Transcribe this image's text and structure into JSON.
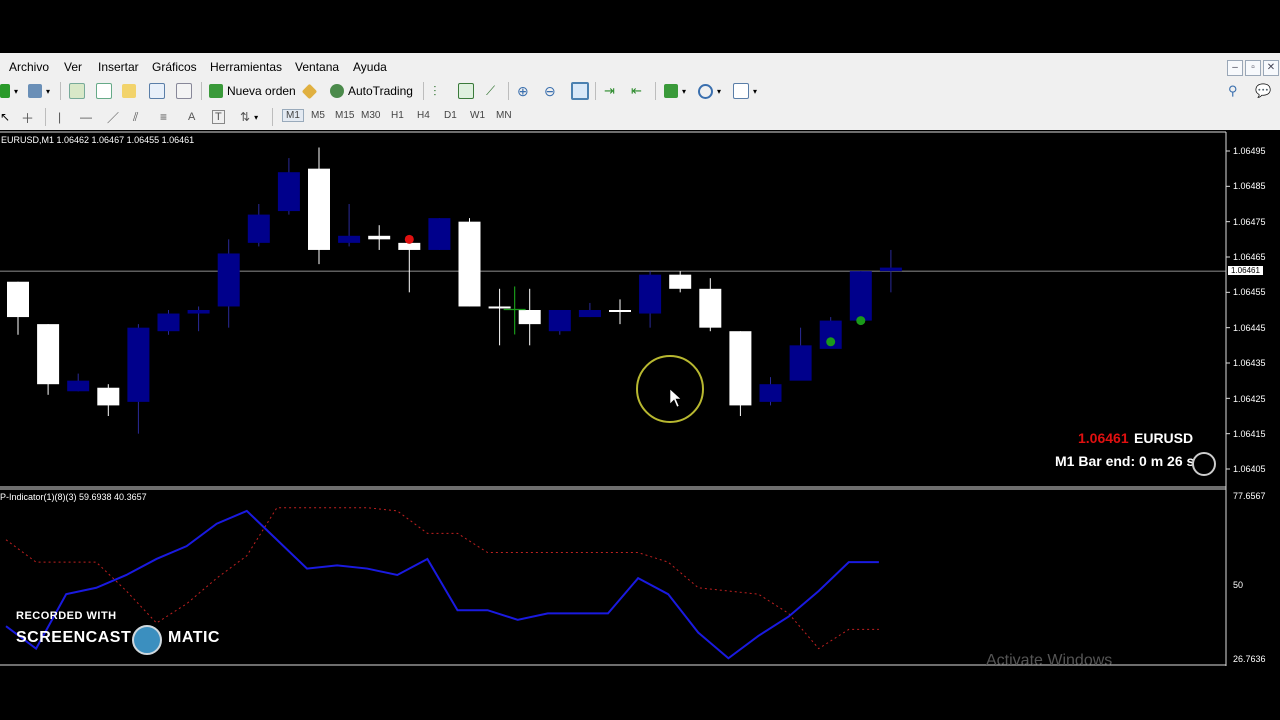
{
  "menu": {
    "items": [
      "Archivo",
      "Ver",
      "Insertar",
      "Gráficos",
      "Herramientas",
      "Ventana",
      "Ayuda"
    ]
  },
  "toolbar": {
    "new_order_label": "Nueva orden",
    "autotrading_label": "AutoTrading",
    "timeframes": [
      "M1",
      "M5",
      "M15",
      "M30",
      "H1",
      "H4",
      "D1",
      "W1",
      "MN"
    ],
    "active_timeframe": "M1"
  },
  "chart": {
    "symbol_info": "EURUSD,M1  1.06462 1.06467 1.06455 1.06461",
    "current_price": "1.06461",
    "price_axis": [
      "1.06495",
      "1.06485",
      "1.06475",
      "1.06465",
      "1.06455",
      "1.06445",
      "1.06435",
      "1.06425",
      "1.06415",
      "1.06405"
    ],
    "current_price_tag": "1.06461",
    "info_price": "1.06461",
    "info_symbol": "EURUSD",
    "bar_end": "M1 Bar end: 0 m 26 s",
    "up_color": "#ffffff",
    "down_color": "#00008b",
    "candles": [
      {
        "o": 1.06448,
        "h": 1.06458,
        "l": 1.06443,
        "c": 1.06458
      },
      {
        "o": 1.06429,
        "h": 1.06446,
        "l": 1.06426,
        "c": 1.06446
      },
      {
        "o": 1.0643,
        "h": 1.06432,
        "l": 1.06427,
        "c": 1.06427
      },
      {
        "o": 1.06423,
        "h": 1.06429,
        "l": 1.0642,
        "c": 1.06428
      },
      {
        "o": 1.06445,
        "h": 1.06446,
        "l": 1.06415,
        "c": 1.06424
      },
      {
        "o": 1.06449,
        "h": 1.0645,
        "l": 1.06443,
        "c": 1.06444
      },
      {
        "o": 1.0645,
        "h": 1.06451,
        "l": 1.06444,
        "c": 1.06449
      },
      {
        "o": 1.06466,
        "h": 1.0647,
        "l": 1.06445,
        "c": 1.06451
      },
      {
        "o": 1.06477,
        "h": 1.0648,
        "l": 1.06468,
        "c": 1.06469
      },
      {
        "o": 1.06489,
        "h": 1.06493,
        "l": 1.06477,
        "c": 1.06478
      },
      {
        "o": 1.06467,
        "h": 1.06496,
        "l": 1.06463,
        "c": 1.0649
      },
      {
        "o": 1.06471,
        "h": 1.0648,
        "l": 1.06468,
        "c": 1.06469
      },
      {
        "o": 1.0647,
        "h": 1.06474,
        "l": 1.06467,
        "c": 1.06471
      },
      {
        "o": 1.06467,
        "h": 1.0647,
        "l": 1.06455,
        "c": 1.06469
      },
      {
        "o": 1.06476,
        "h": 1.06476,
        "l": 1.06467,
        "c": 1.06467
      },
      {
        "o": 1.06451,
        "h": 1.06476,
        "l": 1.06451,
        "c": 1.06475
      },
      {
        "o": 1.06451,
        "h": 1.06456,
        "l": 1.0644,
        "c": 1.06451
      },
      {
        "o": 1.06446,
        "h": 1.06456,
        "l": 1.0644,
        "c": 1.0645
      },
      {
        "o": 1.0645,
        "h": 1.0645,
        "l": 1.06443,
        "c": 1.06444
      },
      {
        "o": 1.0645,
        "h": 1.06452,
        "l": 1.06448,
        "c": 1.06448
      },
      {
        "o": 1.0645,
        "h": 1.06453,
        "l": 1.06446,
        "c": 1.0645
      },
      {
        "o": 1.0646,
        "h": 1.06461,
        "l": 1.06445,
        "c": 1.06449
      },
      {
        "o": 1.06456,
        "h": 1.06461,
        "l": 1.06455,
        "c": 1.0646
      },
      {
        "o": 1.06445,
        "h": 1.06459,
        "l": 1.06444,
        "c": 1.06456
      },
      {
        "o": 1.06423,
        "h": 1.06444,
        "l": 1.0642,
        "c": 1.06444
      },
      {
        "o": 1.06429,
        "h": 1.06431,
        "l": 1.06423,
        "c": 1.06424
      },
      {
        "o": 1.0644,
        "h": 1.06445,
        "l": 1.06431,
        "c": 1.0643
      },
      {
        "o": 1.06447,
        "h": 1.06448,
        "l": 1.06441,
        "c": 1.06439
      },
      {
        "o": 1.06461,
        "h": 1.06461,
        "l": 1.06446,
        "c": 1.06447
      },
      {
        "o": 1.06462,
        "h": 1.06467,
        "l": 1.06455,
        "c": 1.06461
      }
    ],
    "markers": [
      {
        "index": 13,
        "price": 1.0647,
        "color": "#e01010"
      },
      {
        "index": 27,
        "price": 1.06441,
        "color": "#1a9a1a"
      },
      {
        "index": 28,
        "price": 1.06447,
        "color": "#1a9a1a"
      }
    ],
    "cross_marker": {
      "index": 16.5,
      "price": 1.06451,
      "color": "#1a9a1a"
    }
  },
  "indicator": {
    "info": "P-Indicator(1)(8)(3) 59.6938 40.3657",
    "scale": [
      "77.6567",
      "50",
      "26.7636"
    ],
    "blue_color": "#1a1ae0",
    "red_color": "#c02020",
    "blue": [
      37,
      30,
      47,
      49,
      53,
      58,
      62,
      69,
      73,
      64,
      55,
      56,
      55,
      53,
      58,
      42,
      42,
      39,
      41,
      41,
      41,
      52,
      47,
      35,
      27,
      34,
      40,
      48,
      57,
      57
    ],
    "red": [
      64,
      57,
      57,
      57,
      48,
      38,
      44,
      52,
      59,
      74,
      74,
      74,
      74,
      73,
      66,
      66,
      60,
      60,
      60,
      60,
      60,
      60,
      57,
      49,
      48,
      47,
      41,
      30,
      36,
      36
    ]
  },
  "overlay": {
    "recorded_with": "RECORDED WITH",
    "screencast": "SCREENCAST",
    "matic": "MATIC",
    "activate_windows": "Activate Windows"
  }
}
